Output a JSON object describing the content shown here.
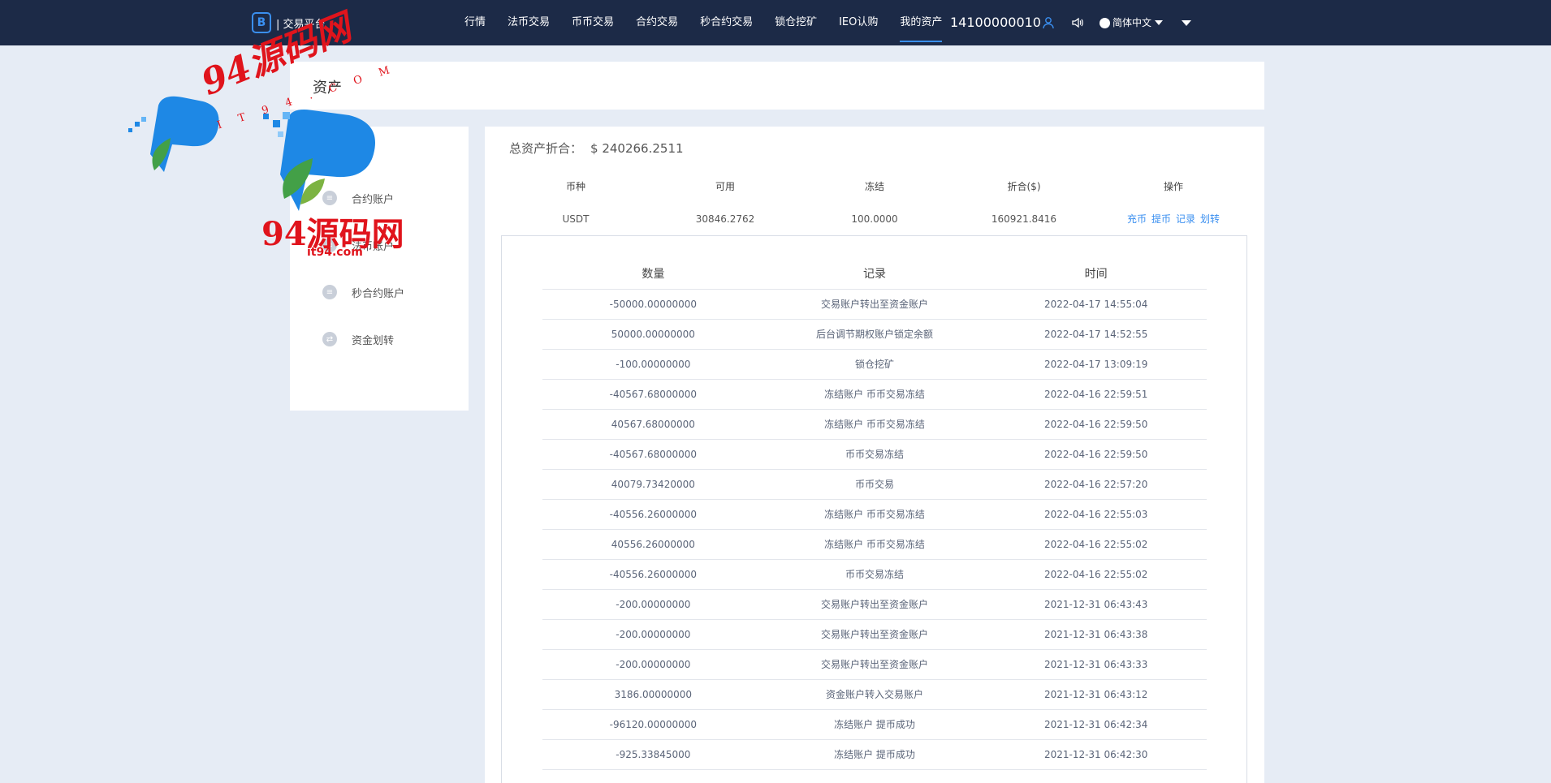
{
  "header": {
    "brand_logo": "B",
    "brand_text": "| 交易平台",
    "nav": [
      "行情",
      "法币交易",
      "币币交易",
      "合约交易",
      "秒合约交易",
      "锁仓挖矿",
      "IEO认购",
      "我的资产"
    ],
    "active_nav": "我的资产",
    "phone": "14100000010",
    "language": "简体中文",
    "icons": [
      "user-icon",
      "speaker-icon",
      "globe-icon"
    ]
  },
  "title": "资产",
  "sidebar": {
    "items": [
      {
        "label": "账户",
        "icon": "wallet-icon",
        "active": true
      },
      {
        "label": "合约账户",
        "icon": "contract-icon"
      },
      {
        "label": "法币账户",
        "icon": "fiat-icon"
      },
      {
        "label": "秒合约账户",
        "icon": "second-contract-icon"
      },
      {
        "label": "资金划转",
        "icon": "transfer-icon"
      }
    ]
  },
  "total": {
    "label": "总资产折合：",
    "value": "$ 240266.2511"
  },
  "asset_table": {
    "headers": [
      "币种",
      "可用",
      "冻结",
      "折合($)",
      "操作"
    ],
    "rows": [
      {
        "coin": "USDT",
        "available": "30846.2762",
        "frozen": "100.0000",
        "value": "160921.8416"
      }
    ],
    "actions": [
      "充币",
      "提币",
      "记录",
      "划转"
    ]
  },
  "records": {
    "headers": [
      "数量",
      "记录",
      "时间"
    ],
    "rows": [
      {
        "amount": "-50000.00000000",
        "note": "交易账户转出至资金账户",
        "time": "2022-04-17 14:55:04"
      },
      {
        "amount": "50000.00000000",
        "note": "后台调节期权账户锁定余额",
        "time": "2022-04-17 14:52:55"
      },
      {
        "amount": "-100.00000000",
        "note": "锁仓挖矿",
        "time": "2022-04-17 13:09:19"
      },
      {
        "amount": "-40567.68000000",
        "note": "冻结账户 币币交易冻结",
        "time": "2022-04-16 22:59:51"
      },
      {
        "amount": "40567.68000000",
        "note": "冻结账户 币币交易冻结",
        "time": "2022-04-16 22:59:50"
      },
      {
        "amount": "-40567.68000000",
        "note": "币币交易冻结",
        "time": "2022-04-16 22:59:50"
      },
      {
        "amount": "40079.73420000",
        "note": "币币交易",
        "time": "2022-04-16 22:57:20"
      },
      {
        "amount": "-40556.26000000",
        "note": "冻结账户 币币交易冻结",
        "time": "2022-04-16 22:55:03"
      },
      {
        "amount": "40556.26000000",
        "note": "冻结账户 币币交易冻结",
        "time": "2022-04-16 22:55:02"
      },
      {
        "amount": "-40556.26000000",
        "note": "币币交易冻结",
        "time": "2022-04-16 22:55:02"
      },
      {
        "amount": "-200.00000000",
        "note": "交易账户转出至资金账户",
        "time": "2021-12-31 06:43:43"
      },
      {
        "amount": "-200.00000000",
        "note": "交易账户转出至资金账户",
        "time": "2021-12-31 06:43:38"
      },
      {
        "amount": "-200.00000000",
        "note": "交易账户转出至资金账户",
        "time": "2021-12-31 06:43:33"
      },
      {
        "amount": "3186.00000000",
        "note": "资金账户转入交易账户",
        "time": "2021-12-31 06:43:12"
      },
      {
        "amount": "-96120.00000000",
        "note": "冻结账户 提币成功",
        "time": "2021-12-31 06:42:34"
      },
      {
        "amount": "-925.33845000",
        "note": "冻结账户 提币成功",
        "time": "2021-12-31 06:42:30"
      }
    ]
  },
  "watermark": {
    "text_top": "94源码网",
    "text_sub": "IT94.COM",
    "text_big": "94源码网",
    "text_url": "it94.com",
    "colors": {
      "red": "#e0141c",
      "blue": "#1e88e5",
      "green": "#43a047"
    }
  }
}
